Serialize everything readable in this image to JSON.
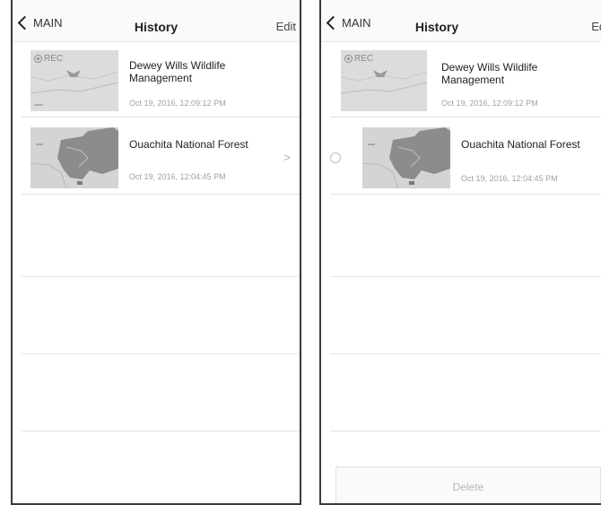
{
  "left": {
    "nav": {
      "back_label": "MAIN",
      "title": "History",
      "edit_label": "Edit"
    },
    "items": [
      {
        "title": "Dewey Wills Wildlife Management",
        "date": "Oct 19, 2016, 12:09:12 PM",
        "badge": "REC"
      },
      {
        "title": "Ouachita National Forest",
        "date": "Oct 19, 2016, 12:04:45 PM",
        "disclosure": ">"
      }
    ]
  },
  "right": {
    "nav": {
      "back_label": "MAIN",
      "title": "History",
      "edit_label": "Edi"
    },
    "items": [
      {
        "title": "Dewey Wills Wildlife Management",
        "date": "Oct 19, 2016, 12:09:12 PM",
        "badge": "REC"
      },
      {
        "title": "Ouachita National Forest",
        "date": "Oct 19, 2016, 12:04:45 PM"
      }
    ],
    "delete_label": "Delete"
  },
  "colors": {
    "border": "#3a3a3a",
    "map_gray": "#d9d9d9",
    "map_dark": "#8c8c8c",
    "date_text": "#a0a0a0"
  },
  "icons": [
    "chevron-left-icon",
    "record-icon",
    "chevron-right-icon",
    "radio-icon"
  ]
}
